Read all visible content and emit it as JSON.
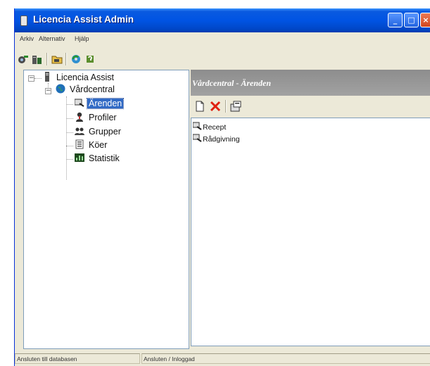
{
  "window": {
    "title": "Licencia Assist Admin",
    "controls": [
      "minimize-icon",
      "maximize-icon",
      "close-icon"
    ]
  },
  "menu": {
    "items": [
      {
        "label": "Arkiv"
      },
      {
        "label": "Alternativ"
      },
      {
        "label": "Hjälp"
      }
    ]
  },
  "toolbar": {
    "buttons": [
      "connect-icon",
      "database-icon",
      "folder-icon",
      "refresh-icon",
      "help-icon"
    ]
  },
  "tree": {
    "root": {
      "label": "Licencia Assist",
      "icon": "server-icon"
    },
    "child": {
      "label": "Vårdcentral",
      "icon": "globe-icon"
    },
    "items": [
      {
        "label": "Ärenden",
        "icon": "case-icon",
        "selected": true
      },
      {
        "label": "Profiler",
        "icon": "profile-icon"
      },
      {
        "label": "Grupper",
        "icon": "group-icon"
      },
      {
        "label": "Köer",
        "icon": "queue-icon"
      },
      {
        "label": "Statistik",
        "icon": "statistics-icon"
      }
    ]
  },
  "panel": {
    "header": "Vårdcentral - Ärenden",
    "toolbar": [
      "new-icon",
      "delete-icon",
      "properties-icon"
    ],
    "items": [
      {
        "label": "Recept",
        "icon": "case-icon"
      },
      {
        "label": "Rådgivning",
        "icon": "case-icon"
      }
    ]
  },
  "status": {
    "left": "Ansluten till databasen",
    "right": "Ansluten / Inloggad"
  },
  "colors": {
    "titlebar": "#0054e3",
    "selection": "#316ac5",
    "panel_header": "#9a9a9a",
    "window_face": "#ece9d8"
  }
}
